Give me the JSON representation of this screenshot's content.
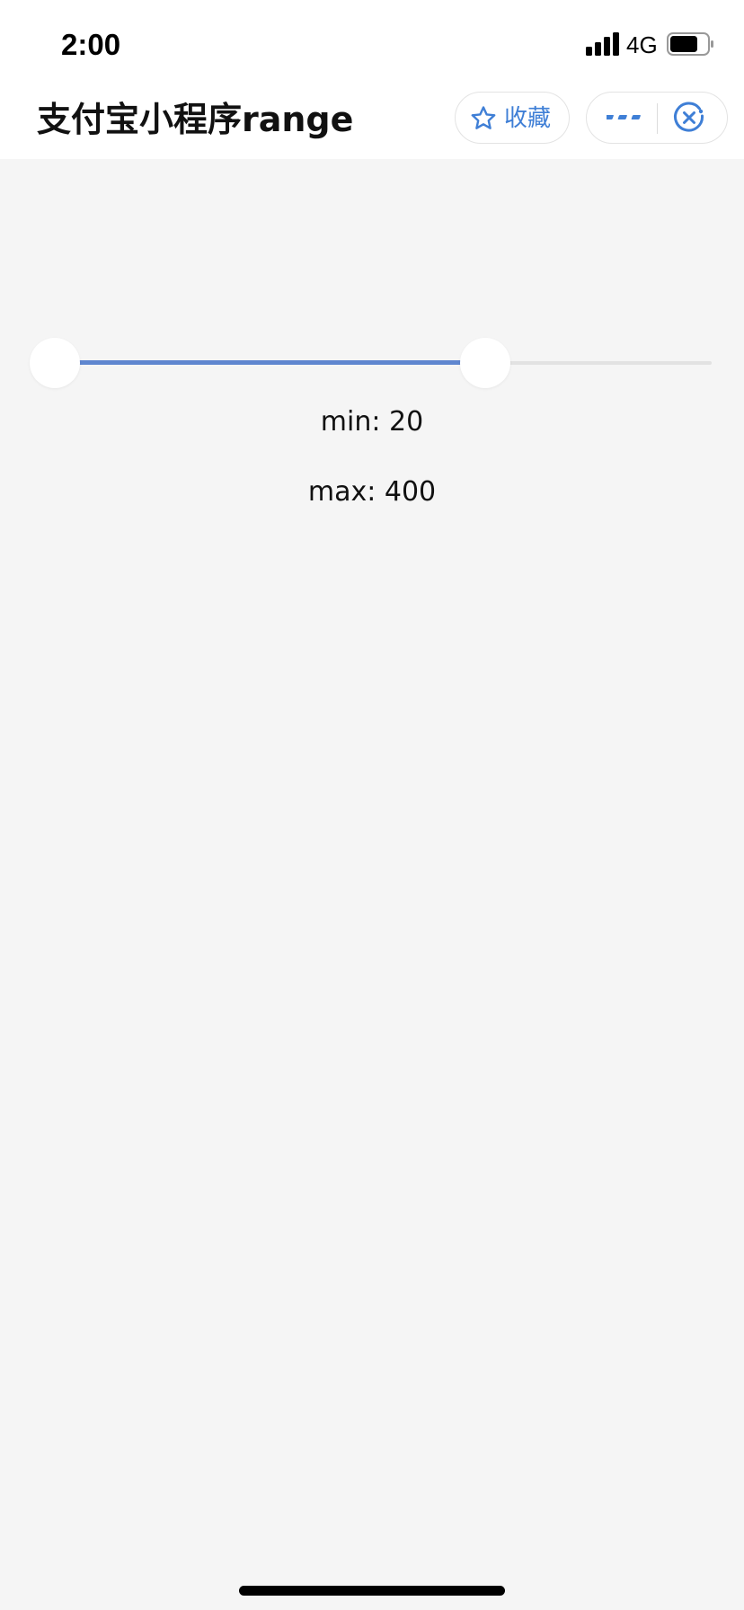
{
  "status_bar": {
    "time": "2:00",
    "network": "4G",
    "battery_level": 0.75,
    "signal_bars": 4
  },
  "nav": {
    "title": "支付宝小程序range",
    "favorite_label": "收藏",
    "accent_color": "#3f7fd6"
  },
  "range": {
    "min_value": 20,
    "max_value": 400,
    "scale_min": 0,
    "scale_max": 600,
    "track_color": "#e2e2e2",
    "fill_color": "#5f86cf"
  },
  "labels": {
    "min_text": "min: 20",
    "max_text": "max: 400"
  },
  "icons": {
    "signal": "signal-icon",
    "battery": "battery-icon",
    "favorite": "star-icon",
    "more": "more-icon",
    "close": "close-icon"
  }
}
